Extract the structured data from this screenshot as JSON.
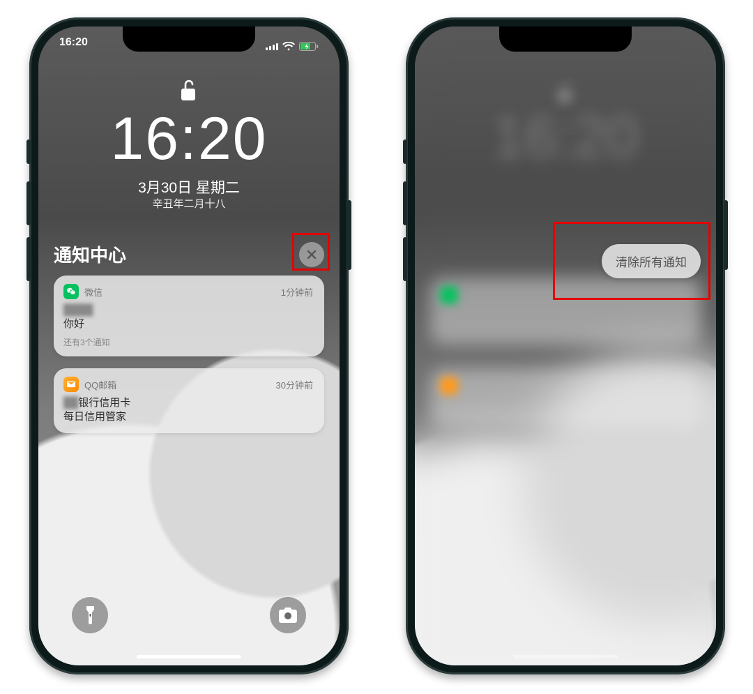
{
  "left": {
    "status_time": "16:20",
    "big_time": "16:20",
    "date": "3月30日 星期二",
    "lunar": "辛丑年二月十八",
    "nc_title": "通知中心",
    "notifications": [
      {
        "app": "微信",
        "icon": "wechat-icon",
        "time": "1分钟前",
        "sender_blur": "████",
        "message": "你好",
        "extra": "还有3个通知"
      },
      {
        "app": "QQ邮箱",
        "icon": "qqmail-icon",
        "time": "30分钟前",
        "sender_blur": "██",
        "sender_suffix": "银行信用卡",
        "message": "每日信用管家",
        "extra": ""
      }
    ]
  },
  "right": {
    "clear_all_label": "清除所有通知"
  },
  "colors": {
    "highlight_red": "#e40202",
    "wechat_green": "#07c160",
    "qqmail_orange": "#ff9a1e"
  }
}
